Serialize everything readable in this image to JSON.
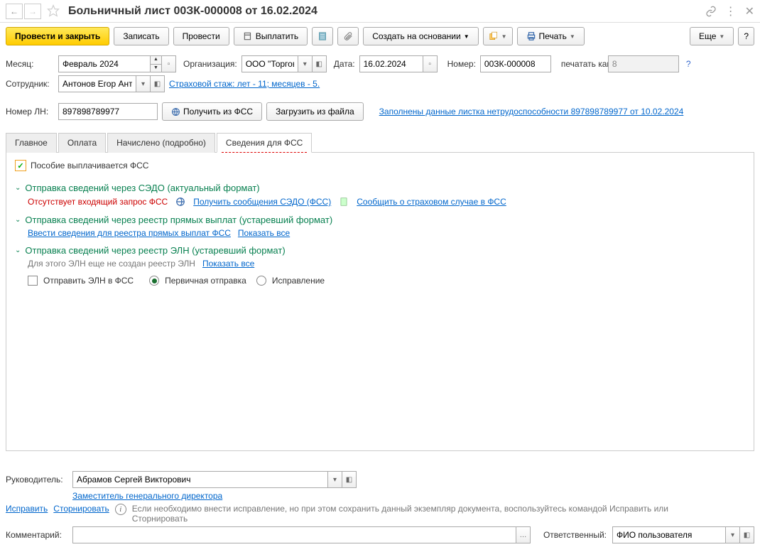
{
  "header": {
    "title": "Больничный лист 00ЗК-000008 от 16.02.2024"
  },
  "toolbar": {
    "post_close": "Провести и закрыть",
    "save": "Записать",
    "post": "Провести",
    "pay": "Выплатить",
    "create_based": "Создать на основании",
    "print": "Печать",
    "more": "Еще"
  },
  "fields": {
    "month_label": "Месяц:",
    "month_value": "Февраль 2024",
    "org_label": "Организация:",
    "org_value": "ООО \"Торгов",
    "date_label": "Дата:",
    "date_value": "16.02.2024",
    "number_label": "Номер:",
    "number_value": "00ЗК-000008",
    "print_as_label": "печатать как:",
    "print_as_value": "8",
    "employee_label": "Сотрудник:",
    "employee_value": "Антонов Егор Ант",
    "seniority_link": "Страховой стаж: лет - 11; месяцев - 5.",
    "ln_label": "Номер ЛН:",
    "ln_value": "897898789977",
    "get_fss": "Получить из ФСС",
    "load_file": "Загрузить из файла",
    "ln_data_link": "Заполнены данные листка нетрудоспособности 897898789977 от 10.02.2024"
  },
  "tabs": [
    "Главное",
    "Оплата",
    "Начислено (подробно)",
    "Сведения для ФСС"
  ],
  "fss_tab": {
    "fss_pays": "Пособие выплачивается ФСС",
    "sec1_title": "Отправка сведений через СЭДО (актуальный формат)",
    "sec1_warn": "Отсутствует входящий запрос ФСС",
    "sec1_link1": "Получить сообщения СЭДО (ФСС)",
    "sec1_link2": "Сообщить о страховом случае в ФСС",
    "sec2_title": "Отправка сведений через реестр прямых выплат (устаревший формат)",
    "sec2_link1": "Ввести сведения для реестра прямых выплат ФСС",
    "sec2_link2": "Показать все",
    "sec3_title": "Отправка сведений через реестр ЭЛН (устаревший формат)",
    "sec3_text": "Для этого ЭЛН еще не создан реестр ЭЛН",
    "sec3_link": "Показать все",
    "send_eln": "Отправить ЭЛН в ФСС",
    "radio_primary": "Первичная отправка",
    "radio_fix": "Исправление"
  },
  "footer": {
    "manager_label": "Руководитель:",
    "manager_value": "Абрамов Сергей Викторович",
    "manager_pos": "Заместитель генерального директора",
    "fix_link": "Исправить",
    "storno_link": "Сторнировать",
    "info_text": "Если необходимо внести исправление, но при этом сохранить данный экземпляр документа, воспользуйтесь командой Исправить или Сторнировать",
    "comment_label": "Комментарий:",
    "responsible_label": "Ответственный:",
    "responsible_value": "ФИО пользователя"
  }
}
